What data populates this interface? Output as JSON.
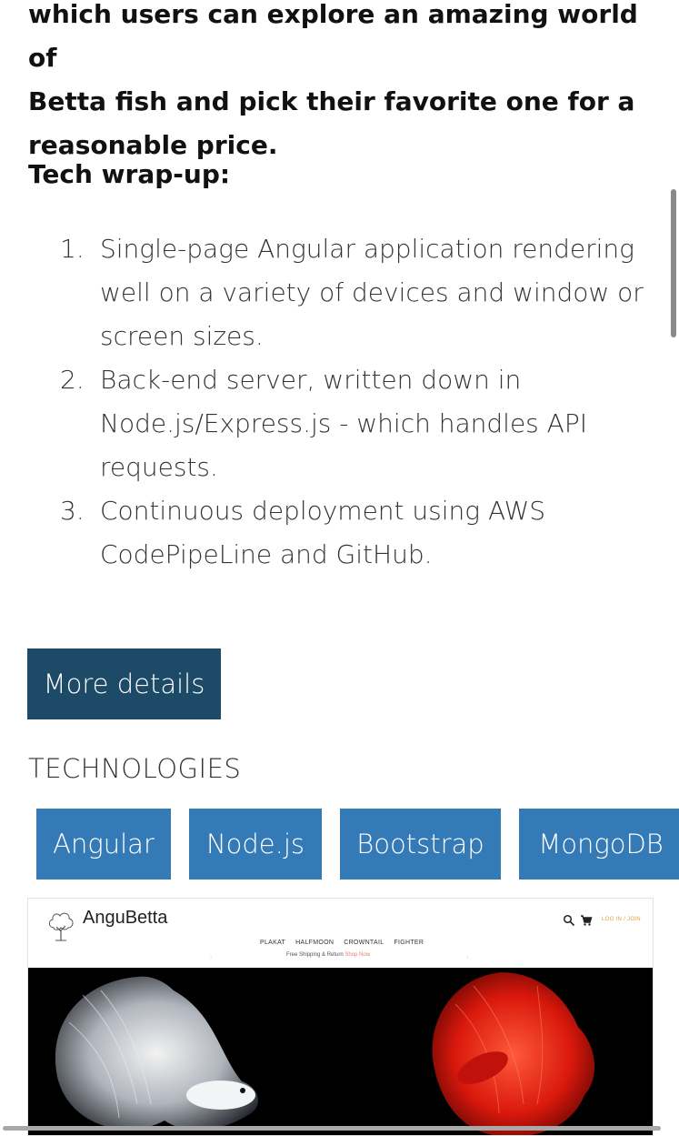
{
  "intro": {
    "lines": [
      "which users can explore an amazing world of",
      "Betta fish and pick their favorite one for a",
      "reasonable price."
    ]
  },
  "tech_wrapup": {
    "heading": "Tech wrap-up:",
    "items": [
      {
        "num": "1.",
        "lines": [
          "Single-page Angular application rendering",
          "well on a variety of devices and window or",
          "screen sizes."
        ]
      },
      {
        "num": "2.",
        "lines": [
          "Back-end server, written down in",
          "Node.js/Express.js - which handles API",
          "requests."
        ]
      },
      {
        "num": "3.",
        "lines": [
          "Continuous deployment using AWS",
          "CodePipeLine and GitHub."
        ]
      }
    ]
  },
  "more_details_label": "More details",
  "technologies": {
    "title": "TECHNOLOGIES",
    "tags": [
      "Angular",
      "Node.js",
      "Bootstrap",
      "MongoDB"
    ]
  },
  "preview": {
    "brand": "AnguBetta",
    "login": "LOG IN / JOIN",
    "nav": [
      "PLAKAT",
      "HALFMOON",
      "CROWNTAIL",
      "FIGHTER"
    ],
    "shipping": "Free Shipping & Return",
    "shop_now": "Shop Now",
    "icons": [
      "tree-logo-icon",
      "search-icon",
      "cart-icon",
      "chevron-left-icon",
      "chevron-right-icon"
    ]
  },
  "colors": {
    "button": "#1d4a66",
    "tag": "#337ab7",
    "accent": "#e0a23b"
  }
}
